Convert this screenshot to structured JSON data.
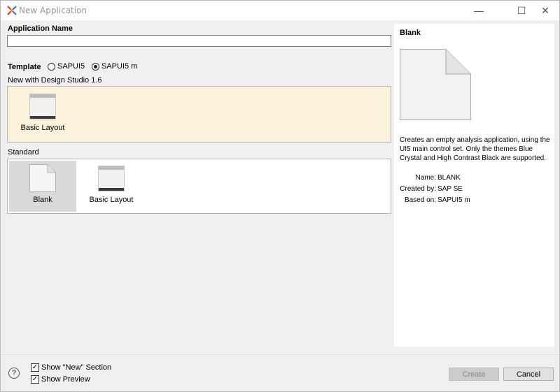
{
  "window": {
    "title": "New Application",
    "minimize_glyph": "—",
    "maximize_glyph": "☐",
    "close_glyph": "✕"
  },
  "form": {
    "app_name_label": "Application Name",
    "app_name_value": "",
    "template_label": "Template",
    "template_options": [
      {
        "label": "SAPUI5",
        "selected": false
      },
      {
        "label": "SAPUI5 m",
        "selected": true
      }
    ]
  },
  "sections": {
    "new_with_label": "New with Design Studio 1.6",
    "new_with_items": [
      {
        "label": "Basic Layout",
        "icon": "basic-layout-icon"
      }
    ],
    "standard_label": "Standard",
    "standard_items": [
      {
        "label": "Blank",
        "icon": "blank-page-icon",
        "selected": true
      },
      {
        "label": "Basic Layout",
        "icon": "basic-layout-icon",
        "selected": false
      }
    ]
  },
  "preview": {
    "title": "Blank",
    "description": "Creates an empty analysis application, using the UI5 main control set. Only the themes Blue Crystal and High Contrast Black are supported.",
    "name_key": "Name:",
    "name_value": "BLANK",
    "created_by_key": "Created by:",
    "created_by_value": "SAP SE",
    "based_on_key": "Based on:",
    "based_on_value": "SAPUI5 m"
  },
  "footer": {
    "help_glyph": "?",
    "show_new_label": "Show \"New\" Section",
    "show_new_checked": true,
    "show_preview_label": "Show Preview",
    "show_preview_checked": true,
    "create_label": "Create",
    "cancel_label": "Cancel"
  },
  "colors": {
    "new_section_bg": "#fbf2dc",
    "selected_tile_bg": "#d9d9d9",
    "disabled_button_bg": "#cccccc"
  }
}
